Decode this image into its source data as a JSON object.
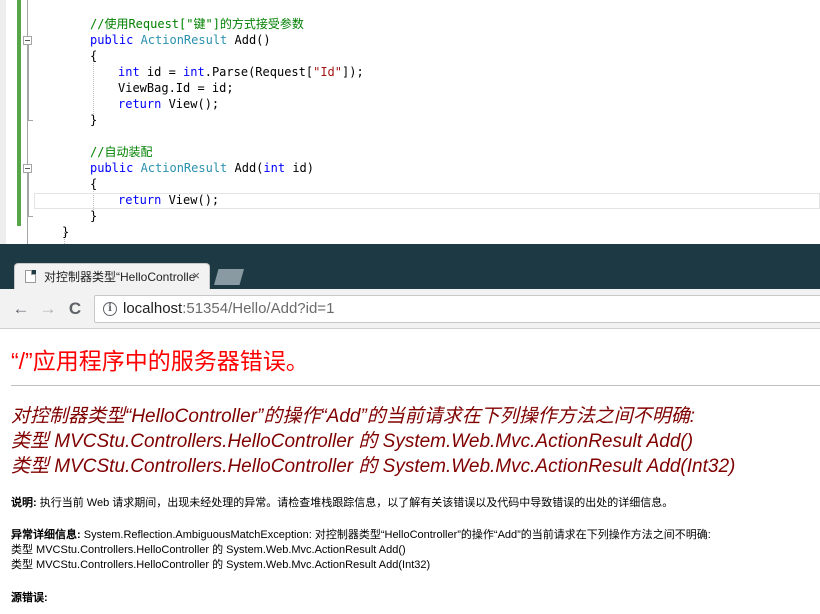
{
  "editor": {
    "lines": [
      {
        "parts": [
          {
            "c": "cm",
            "t": "//使用Request[\"键\"]的方式接受参数"
          }
        ]
      },
      {
        "parts": [
          {
            "c": "kw",
            "t": "public "
          },
          {
            "c": "ty",
            "t": "ActionResult"
          },
          {
            "c": "pl",
            "t": " Add()"
          }
        ]
      },
      {
        "parts": [
          {
            "c": "pl",
            "t": "{"
          }
        ]
      },
      {
        "parts": [
          {
            "c": "kw",
            "t": "int"
          },
          {
            "c": "pl",
            "t": " id = "
          },
          {
            "c": "kw",
            "t": "int"
          },
          {
            "c": "pl",
            "t": ".Parse(Request["
          },
          {
            "c": "st",
            "t": "\"Id\""
          },
          {
            "c": "pl",
            "t": "]);"
          }
        ]
      },
      {
        "parts": [
          {
            "c": "pl",
            "t": "ViewBag.Id = id;"
          }
        ]
      },
      {
        "parts": [
          {
            "c": "kw",
            "t": "return "
          },
          {
            "c": "pl",
            "t": "View();"
          }
        ]
      },
      {
        "parts": [
          {
            "c": "pl",
            "t": "}"
          }
        ]
      },
      {
        "parts": []
      },
      {
        "parts": [
          {
            "c": "cm",
            "t": "//自动装配"
          }
        ]
      },
      {
        "parts": [
          {
            "c": "kw",
            "t": "public "
          },
          {
            "c": "ty",
            "t": "ActionResult"
          },
          {
            "c": "pl",
            "t": " Add("
          },
          {
            "c": "kw",
            "t": "int"
          },
          {
            "c": "pl",
            "t": " id)"
          }
        ]
      },
      {
        "parts": [
          {
            "c": "pl",
            "t": "{"
          }
        ]
      },
      {
        "parts": [
          {
            "c": "kw",
            "t": "return "
          },
          {
            "c": "pl",
            "t": "View();"
          }
        ]
      },
      {
        "parts": [
          {
            "c": "pl",
            "t": "}"
          }
        ]
      },
      {
        "parts": [
          {
            "c": "pl",
            "t": "}"
          }
        ]
      }
    ]
  },
  "browser": {
    "tab_title": "对控制器类型“HelloController”的操作“Add”的当前请求在下列操作方法之间不明确",
    "tab_close": "×",
    "nav": {
      "back": "←",
      "forward": "→",
      "reload": "C"
    },
    "url_host": "localhost",
    "url_rest": ":51354/Hello/Add?id=1",
    "info_glyph": "i"
  },
  "page": {
    "title": "“/”应用程序中的服务器错误。",
    "error_lines": [
      "对控制器类型“HelloController”的操作“Add”的当前请求在下列操作方法之间不明确:",
      "类型 MVCStu.Controllers.HelloController 的 System.Web.Mvc.ActionResult Add()",
      "类型 MVCStu.Controllers.HelloController 的 System.Web.Mvc.ActionResult Add(Int32)"
    ],
    "description_label": "说明:",
    "description_text": " 执行当前 Web 请求期间，出现未经处理的异常。请检查堆栈跟踪信息，以了解有关该错误以及代码中导致错误的出处的详细信息。",
    "exception_label": "异常详细信息:",
    "exception_text": " System.Reflection.AmbiguousMatchException: 对控制器类型“HelloController”的操作“Add”的当前请求在下列操作方法之间不明确:",
    "exception_lines": [
      "类型 MVCStu.Controllers.HelloController 的 System.Web.Mvc.ActionResult Add()",
      "类型 MVCStu.Controllers.HelloController 的 System.Web.Mvc.ActionResult Add(Int32)"
    ],
    "source_label": "源错误:"
  }
}
